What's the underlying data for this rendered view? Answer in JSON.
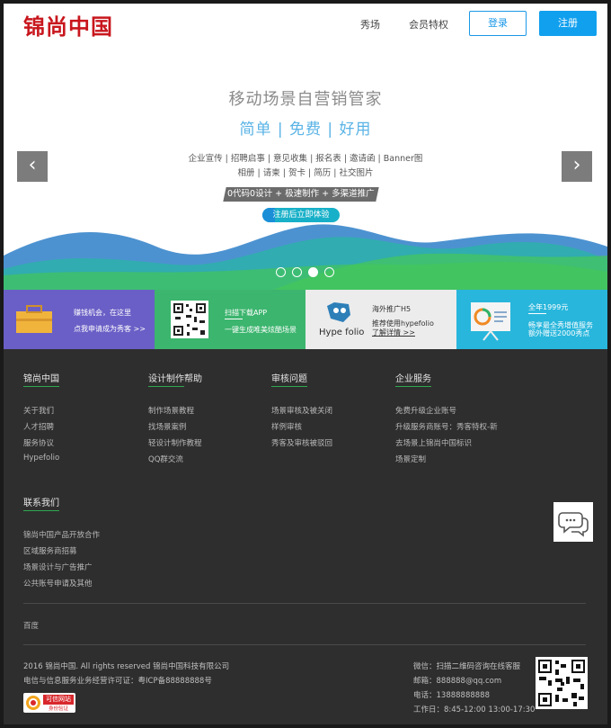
{
  "header": {
    "logo": "锦尚中国",
    "nav": [
      "秀场",
      "会员特权"
    ],
    "login_label": "登录",
    "register_label": "注册"
  },
  "hero": {
    "title": "移动场景自营销管家",
    "subtitle": "简单 | 免费 | 好用",
    "line1": "企业宣传 | 招聘启事 | 意见收集 | 报名表 | 邀请函 | Banner图",
    "line2": "相册 | 请柬 | 贺卡 | 简历 | 社交图片",
    "tagline": "0代码0设计 + 极速制作 + 多渠道推广",
    "cta": "注册后立即体验",
    "prev_glyph": "‹",
    "next_glyph": "›",
    "slide_count": 4,
    "active_slide": 3
  },
  "promos": [
    {
      "line1": "赚钱机会，在这里",
      "line2": "点我申请成为秀客 >>",
      "bg": "#6a5fc6",
      "icon": "briefcase-icon"
    },
    {
      "line1": "扫描下载APP",
      "line2": "一键生成唯美炫酷场景",
      "bg": "#3cb56e",
      "icon": "qr-code-icon"
    },
    {
      "line1": "海外推广H5",
      "line2": "推荐使用hypefolio",
      "line3": "了解详情 >>",
      "brand": "Hype folio",
      "bg": "#ececec",
      "icon": "hypefolio-logo-icon"
    },
    {
      "line1": "全年1999元",
      "line2": "畅享最全秀增值服务",
      "line3": "额外赠送2000秀点",
      "bg": "#28b6dc",
      "icon": "presentation-board-icon"
    }
  ],
  "footer": {
    "columns": [
      {
        "title": "锦尚中国",
        "links": [
          "关于我们",
          "人才招聘",
          "服务协议",
          "Hypefolio"
        ]
      },
      {
        "title": "设计制作帮助",
        "links": [
          "制作场景教程",
          "找场景案例",
          "轻设计制作教程",
          "QQ群交流"
        ]
      },
      {
        "title": "审核问题",
        "links": [
          "场景审核及被关闭",
          "样例审核",
          "秀客及审核被驳回"
        ]
      },
      {
        "title": "企业服务",
        "links": [
          "免费升级企业账号",
          "升级服务商账号：秀客特权-新",
          "去场景上锦尚中国标识",
          "场景定制"
        ]
      }
    ],
    "contact": {
      "title": "联系我们",
      "links": [
        "锦尚中国产品开放合作",
        "区域服务商招募",
        "场景设计与广告推广",
        "公共账号申请及其他"
      ]
    },
    "friend_link": "百度",
    "copyright": "2016 锦尚中国. All rights reserved 锦尚中国科技有限公司",
    "icp": "电信与信息服务业务经营许可证：粤ICP备88888888号",
    "badge_text": "可信网站",
    "badge_sub": "身份验证",
    "wechat": "微信：扫描二维码咨询在线客服",
    "email": "邮箱：888888@qq.com",
    "phone": "电话：13888888888",
    "hours": "工作日：8:45-12:00 13:00-17:30"
  }
}
